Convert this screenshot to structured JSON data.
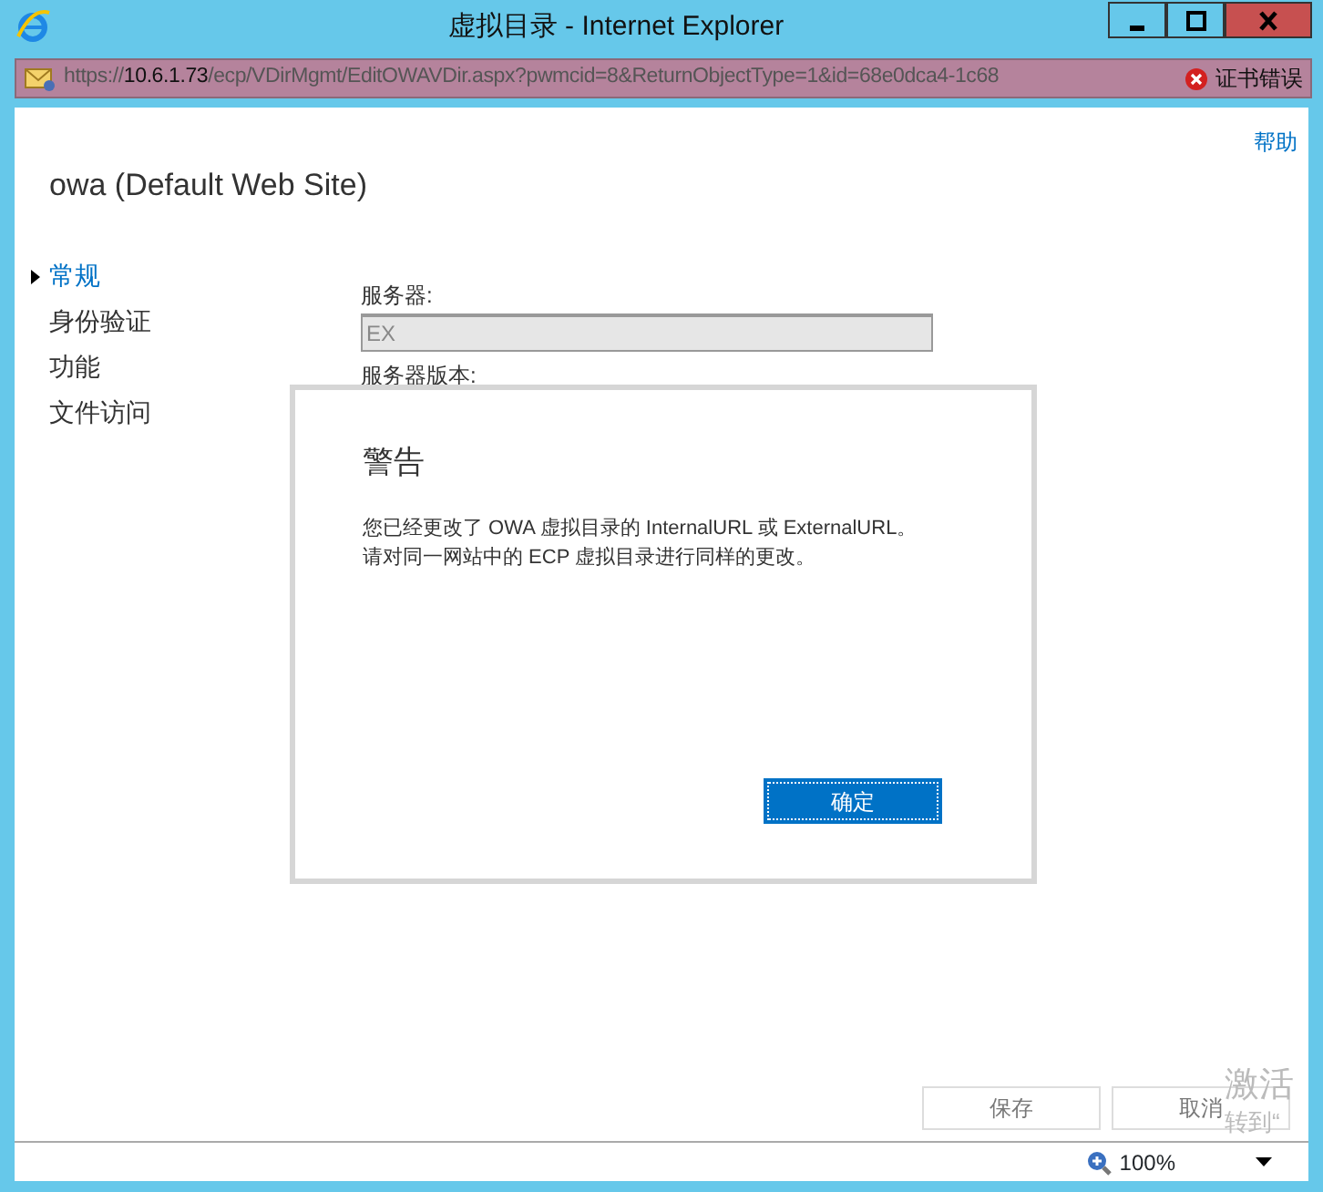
{
  "window": {
    "title": "虚拟目录 - Internet Explorer",
    "controls": [
      {
        "kind": "minimize"
      },
      {
        "kind": "maximize"
      },
      {
        "kind": "close"
      }
    ]
  },
  "address_bar": {
    "scheme": "https://",
    "host": "10.6.1.73",
    "path": "/ecp/VDirMgmt/EditOWAVDir.aspx?pwmcid=8&ReturnObjectType=1&id=68e0dca4-1c68",
    "cert_error": "证书错误"
  },
  "help_link": "帮助",
  "page_title": "owa (Default Web Site)",
  "sidebar": {
    "items": [
      {
        "label": "常规",
        "selected": true
      },
      {
        "label": "身份验证",
        "selected": false
      },
      {
        "label": "功能",
        "selected": false
      },
      {
        "label": "文件访问",
        "selected": false
      }
    ]
  },
  "form": {
    "fields": [
      {
        "label": "服务器:",
        "value": "EX",
        "disabled": true
      }
    ],
    "next_label": "服务器版本:"
  },
  "dialog": {
    "title": "警告",
    "message_lines": [
      "您已经更改了 OWA 虚拟目录的 InternalURL 或 ExternalURL。",
      "请对同一网站中的 ECP 虚拟目录进行同样的更改。"
    ],
    "button": "确定"
  },
  "footer_buttons": [
    {
      "label": "保存",
      "disabled": true
    },
    {
      "label": "取消",
      "disabled": true
    }
  ],
  "activation_notice": [
    "激活",
    "转到“"
  ],
  "status_bar": {
    "zoom": "100%"
  }
}
